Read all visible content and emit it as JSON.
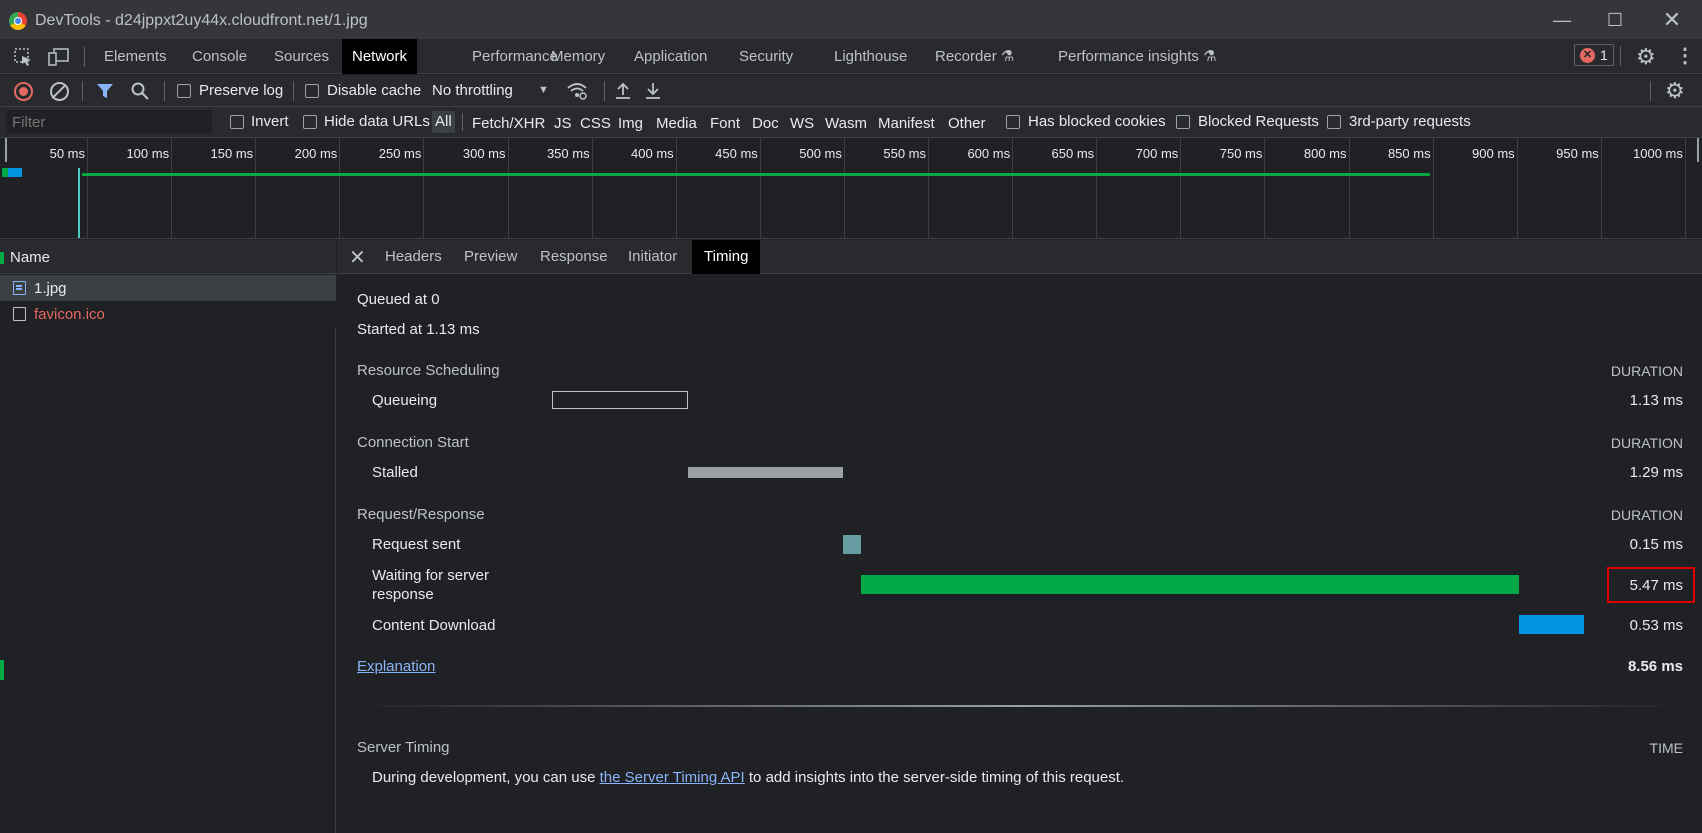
{
  "window": {
    "title": "DevTools - d24jppxt2uy44x.cloudfront.net/1.jpg"
  },
  "main_tabs": [
    "Elements",
    "Console",
    "Sources",
    "Network",
    "Performance",
    "Memory",
    "Application",
    "Security",
    "Lighthouse",
    "Recorder",
    "Performance insights"
  ],
  "active_main_tab": "Network",
  "error_count": "1",
  "toolbar": {
    "preserve_log": "Preserve log",
    "disable_cache": "Disable cache",
    "throttling": "No throttling"
  },
  "filterbar": {
    "placeholder": "Filter",
    "invert": "Invert",
    "hide_data_urls": "Hide data URLs",
    "types": [
      "All",
      "Fetch/XHR",
      "JS",
      "CSS",
      "Img",
      "Media",
      "Font",
      "Doc",
      "WS",
      "Wasm",
      "Manifest",
      "Other"
    ],
    "active_type": "All",
    "has_blocked_cookies": "Has blocked cookies",
    "blocked_requests": "Blocked Requests",
    "third_party": "3rd-party requests"
  },
  "overview_ticks": [
    "50 ms",
    "100 ms",
    "150 ms",
    "200 ms",
    "250 ms",
    "300 ms",
    "350 ms",
    "400 ms",
    "450 ms",
    "500 ms",
    "550 ms",
    "600 ms",
    "650 ms",
    "700 ms",
    "750 ms",
    "800 ms",
    "850 ms",
    "900 ms",
    "950 ms",
    "1000 ms"
  ],
  "requests": {
    "header": "Name",
    "rows": [
      {
        "name": "1.jpg",
        "selected": true,
        "error": false
      },
      {
        "name": "favicon.ico",
        "selected": false,
        "error": true
      }
    ]
  },
  "detail_tabs": [
    "Headers",
    "Preview",
    "Response",
    "Initiator",
    "Timing"
  ],
  "active_detail_tab": "Timing",
  "timing": {
    "queued_at": "Queued at 0",
    "started_at": "Started at 1.13 ms",
    "duration_label": "DURATION",
    "sections": [
      {
        "title": "Resource Scheduling",
        "rows": [
          {
            "label": "Queueing",
            "duration": "1.13 ms",
            "color": "#202124"
          }
        ]
      },
      {
        "title": "Connection Start",
        "rows": [
          {
            "label": "Stalled",
            "duration": "1.29 ms",
            "color": "#9aa0a6"
          }
        ]
      },
      {
        "title": "Request/Response",
        "rows": [
          {
            "label": "Request sent",
            "duration": "0.15 ms",
            "color": "#669ba1"
          },
          {
            "label_line1": "Waiting for server",
            "label_line2": "response",
            "duration": "5.47 ms",
            "color": "#00a846"
          },
          {
            "label": "Content Download",
            "duration": "0.53 ms",
            "color": "#0094e0"
          }
        ]
      }
    ],
    "explanation": "Explanation",
    "total": "8.56 ms"
  },
  "server_timing": {
    "title": "Server Timing",
    "time_label": "TIME",
    "text_before": "During development, you can use ",
    "link": "the Server Timing API",
    "text_after": " to add insights into the server-side timing of this request."
  }
}
